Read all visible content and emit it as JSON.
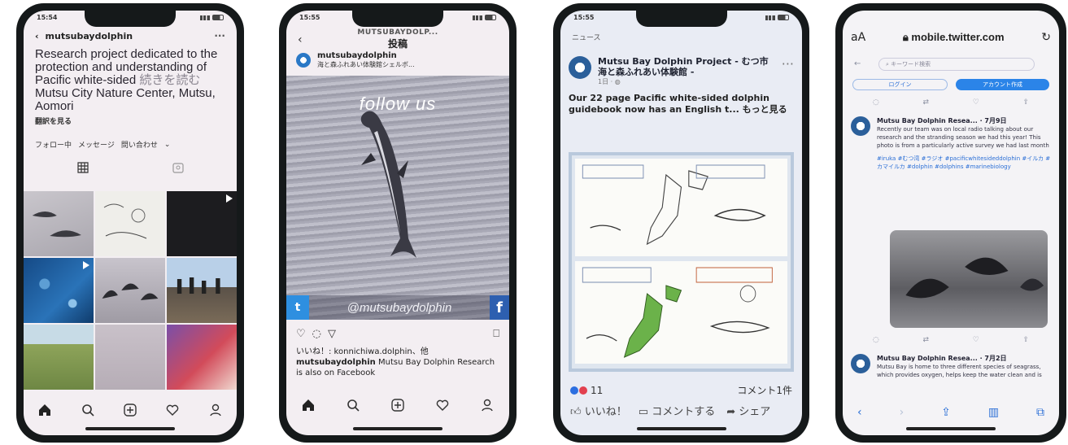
{
  "phone1": {
    "status_time": "15:54",
    "username": "mutsubaydolphin",
    "bio": "Research project dedicated to the protection and understanding of Pacific white-sided",
    "bio_more": "続きを読む",
    "bio_location": "Mutsu City Nature Center, Mutsu, Aomori",
    "translate": "翻訳を見る",
    "buttons": [
      "フォロー中",
      "メッセージ",
      "問い合わせ"
    ]
  },
  "phone2": {
    "status_time": "15:55",
    "header_username": "MUTSUBAYDOLP...",
    "header_title": "投稿",
    "post_user": "mutsubaydolphin",
    "post_sub": "海と森ふれあい体験館シェルボ...",
    "overlay_text": "follow us",
    "handle": "@mutsubaydolphin",
    "likes": "いいね！: konnichiwa.dolphin、他",
    "caption_user": "mutsubaydolphin",
    "caption": "Mutsu Bay Dolphin Research is also on Facebook"
  },
  "phone3": {
    "status_time": "15:55",
    "header": "ニュース",
    "page_name": "Mutsu Bay Dolphin Project - むつ市海と森ふれあい体験館 -",
    "meta": "1日 · ",
    "post_text": "Our 22 page Pacific white-sided dolphin guidebook now has an English t...",
    "see_more": "もっと見る",
    "reactions": "11",
    "comments": "コメント1件",
    "actions": [
      "いいね！",
      "コメントする",
      "シェア"
    ]
  },
  "phone4": {
    "aa": "aA",
    "host": "mobile.twitter.com",
    "search_placeholder": "キーワード検索",
    "login": "ログイン",
    "signup": "アカウント作成",
    "tweet1_name": "Mutsu Bay Dolphin Resea... · 7月9日",
    "tweet1_body": "Recently our team was on local radio talking about our research and the stranding season we had this year! This photo is from a particularly active survey we had last month",
    "tweet1_tags": "#iruka #むつ湾 #ラジオ #pacificwhitesideddolphin #イルカ #カマイルカ #dolphin #dolphins #marinebiology",
    "tweet2_name": "Mutsu Bay Dolphin Resea... · 7月2日",
    "tweet2_body": "Mutsu Bay is home to three different species of seagrass, which provides oxygen, helps keep the water clean and is"
  }
}
